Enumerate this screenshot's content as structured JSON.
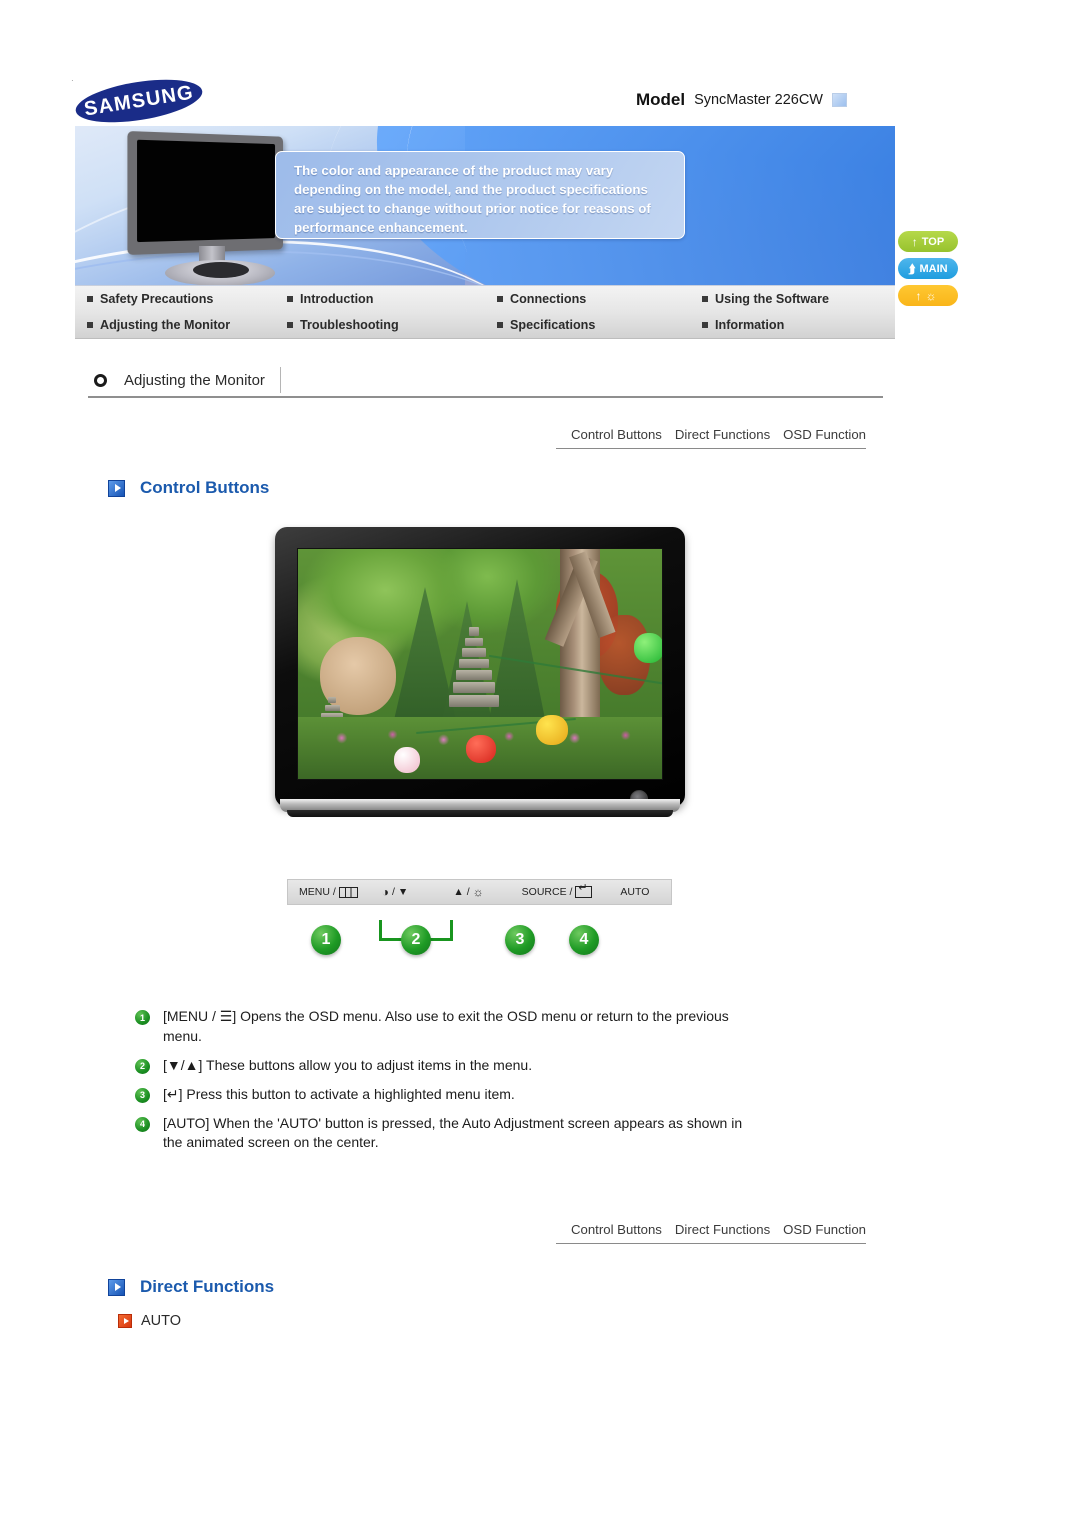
{
  "brand": {
    "logo_text": "SAMSUNG"
  },
  "model": {
    "label": "Model",
    "value": "SyncMaster 226CW"
  },
  "notice": {
    "text": "The color and appearance of the product may vary depending on the model, and the product specifications are subject to change without prior notice for reasons of performance enhancement."
  },
  "nav": {
    "items": [
      "Safety Precautions",
      "Introduction",
      "Connections",
      "Using the Software",
      "Adjusting the Monitor",
      "Troubleshooting",
      "Specifications",
      "Information"
    ]
  },
  "side_buttons": [
    {
      "label": "TOP",
      "icon": "up-arrow-icon",
      "color": "#97c22e"
    },
    {
      "label": "MAIN",
      "icon": "home-arrow-icon",
      "color": "#1f9ddf"
    },
    {
      "label": "",
      "icon": "eye-icon",
      "color": "#f9b519"
    }
  ],
  "section": {
    "title": "Adjusting the Monitor"
  },
  "tabs": [
    "Control Buttons",
    "Direct Functions",
    "OSD Function"
  ],
  "headings": {
    "control_buttons": "Control Buttons",
    "direct_functions": "Direct Functions"
  },
  "control_strip": {
    "items": [
      {
        "text": "MENU /",
        "glyph": "menu-panel-icon"
      },
      {
        "text": "/",
        "glyph": "brightness-down-icon",
        "glyph2": "down-triangle-icon"
      },
      {
        "text": "/",
        "glyph": "up-triangle-icon",
        "glyph2": "sun-icon"
      },
      {
        "text": "SOURCE /",
        "glyph": "enter-icon"
      },
      {
        "text": "AUTO",
        "glyph": ""
      }
    ],
    "menu_label": "MENU /",
    "source_label": "SOURCE /",
    "auto_label": "AUTO"
  },
  "badges": [
    "1",
    "2",
    "3",
    "4"
  ],
  "descriptions": [
    {
      "num": "1",
      "text": "[MENU / ☰] Opens the OSD menu. Also use to exit the OSD menu or return to the previous menu."
    },
    {
      "num": "2",
      "text": "[▼/▲] These buttons allow you to adjust items in the menu."
    },
    {
      "num": "3",
      "text": "[↵] Press this button to activate a highlighted menu item."
    },
    {
      "num": "4",
      "text": "[AUTO] When the 'AUTO' button is pressed, the Auto Adjustment screen appears as shown in the animated screen on the center."
    }
  ],
  "direct_function_items": [
    {
      "label": "AUTO"
    }
  ],
  "colors": {
    "heading_blue": "#1b5aad",
    "badge_green": "#1f9b25",
    "orange": "#d9380f",
    "nav_bg": "#e6e6e6"
  }
}
